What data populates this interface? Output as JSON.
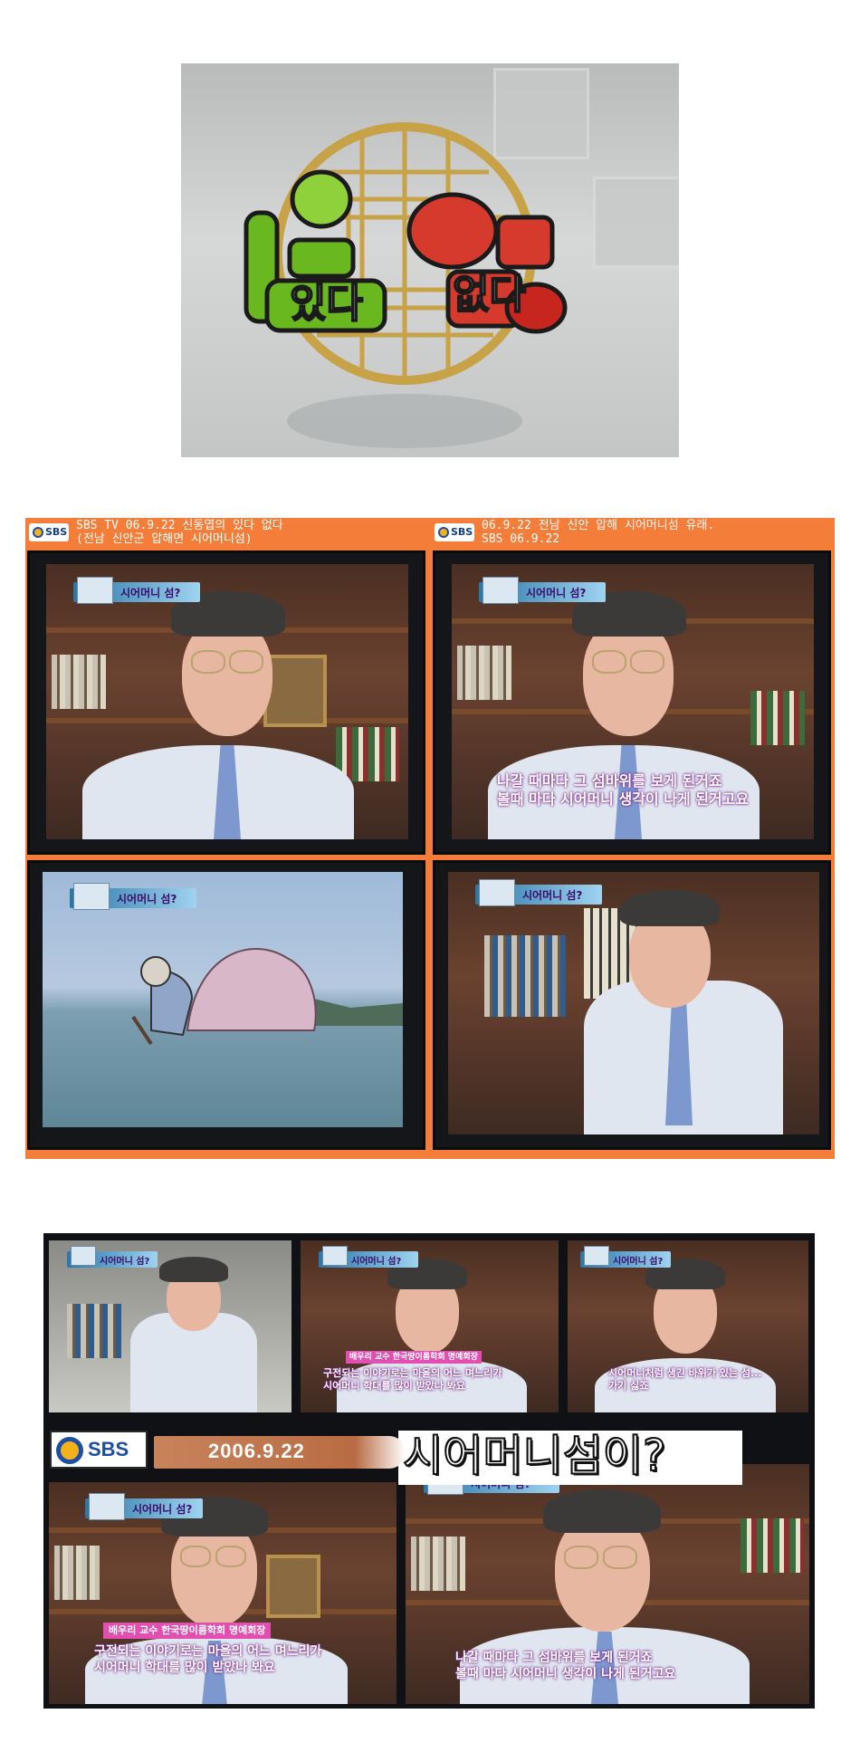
{
  "logo_panel": {
    "logo_word_1": "있다",
    "logo_word_2": "없다",
    "colors": {
      "green": "#6ab81f",
      "red": "#d63a2c",
      "gold": "#c7a246"
    }
  },
  "composite": {
    "captions": [
      {
        "line1": "SBS TV 06.9.22 신동엽의 있다 없다",
        "line2": "(전남 신안군 압해면 시어머니섬)"
      },
      {
        "line1": "06.9.22 전남 신안 압해 시어머니섬 유래.",
        "line2": "SBS 06.9.22"
      }
    ],
    "sbs_mini_label": "SBS",
    "panels": [
      {
        "tag": "시어머니 섬?",
        "subtitle": ""
      },
      {
        "tag": "시어머니 섬?",
        "subtitle": "나갈 때마다 그 섬바위를 보게 된거죠\n볼때 마다 시어머니 생각이 나게 된거고요"
      },
      {
        "tag": "시어머니 섬?",
        "subtitle": ""
      },
      {
        "tag": "시어머니 섬?",
        "subtitle": ""
      }
    ]
  },
  "collage": {
    "top_row": [
      {
        "tag": "시어머니 섬?",
        "subtitle": ""
      },
      {
        "tag": "시어머니 섬?",
        "name_tag": "배우리 교수",
        "affiliation": "한국땅이름학회 명예회장",
        "subtitle": "구전되는 이야기로는 마을의 어느 며느리가\n시어머니 학대를 많이 받았나 봐요"
      },
      {
        "tag": "시어머니 섬?",
        "subtitle": "시어머니처럼 생긴 바위가 있는 섬...\n가기 싫죠"
      }
    ],
    "sbs_logo_text": "SBS",
    "date": "2006.9.22",
    "headline": "시어머니섬이?",
    "bottom_row": [
      {
        "tag": "시어머니 섬?",
        "name_tag": "배우리 교수",
        "affiliation": "한국땅이름학회 명예회장",
        "subtitle": "구전되는 이야기로는 마을의 어느 며느리가\n시어머니 학대를 많이 받았나 봐요"
      },
      {
        "tag": "시어머니 섬?",
        "subtitle": "나갈 때마다 그 섬바위를 보게 된거죠\n볼때 마다 시어머니 생각이 나게 된거고요"
      }
    ]
  }
}
